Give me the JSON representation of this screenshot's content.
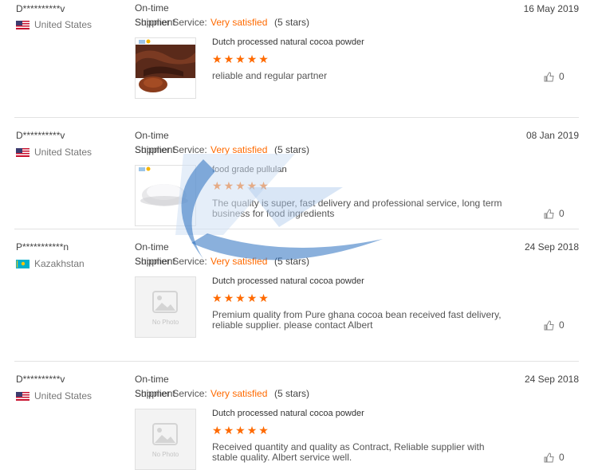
{
  "reviews": [
    {
      "buyer": "D**********v",
      "country": "United States",
      "flag": "us",
      "on_time": "On-time",
      "shipment": "Shipment",
      "supplier_service": "Supplier Service:",
      "satisfaction": "Very satisfied",
      "stars_text": "(5 stars)",
      "date": "16 May 2019",
      "product": "Dutch processed natural cocoa powder",
      "comment": "reliable and regular partner",
      "likes": "0",
      "photo": "cocoa"
    },
    {
      "buyer": "D**********v",
      "country": "United States",
      "flag": "us",
      "on_time": "On-time",
      "shipment": "Shipment",
      "supplier_service": "Supplier Service:",
      "satisfaction": "Very satisfied",
      "stars_text": "(5 stars)",
      "date": "08 Jan 2019",
      "product": "food grade pullulan",
      "comment": "The quality is super, fast delivery and professional service, long term business for food ingredients",
      "likes": "0",
      "photo": "pullulan"
    },
    {
      "buyer": "P***********n",
      "country": "Kazakhstan",
      "flag": "kz",
      "on_time": "On-time",
      "shipment": "Shipment",
      "supplier_service": "Supplier Service:",
      "satisfaction": "Very satisfied",
      "stars_text": "(5 stars)",
      "date": "24 Sep 2018",
      "product": "Dutch processed natural cocoa powder",
      "comment": "Premium quality from Pure ghana cocoa bean received fast delivery, reliable supplier. please contact Albert",
      "likes": "0",
      "photo": "none",
      "no_photo_text": "No Photo"
    },
    {
      "buyer": "D**********v",
      "country": "United States",
      "flag": "us",
      "on_time": "On-time",
      "shipment": "Shipment",
      "supplier_service": "Supplier Service:",
      "satisfaction": "Very satisfied",
      "stars_text": "(5 stars)",
      "date": "24 Sep 2018",
      "product": "Dutch processed natural cocoa powder",
      "comment": "Received quantity and quality as Contract, Reliable supplier with stable quality. Albert service well.",
      "likes": "0",
      "photo": "none",
      "no_photo_text": "No Photo"
    }
  ],
  "rating": 5,
  "colors": {
    "accent": "#ff6a00",
    "divider": "#e2e2e2"
  }
}
